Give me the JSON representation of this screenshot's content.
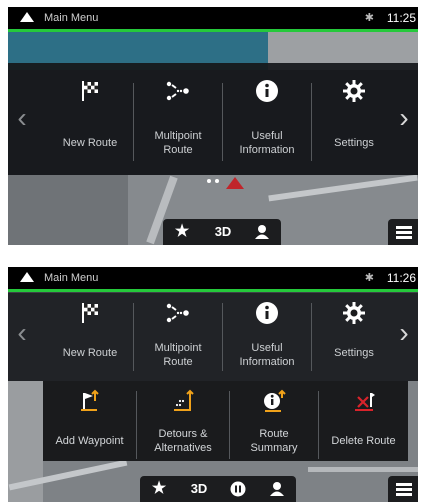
{
  "screens": [
    {
      "status": {
        "title": "Main Menu",
        "time": "11:25"
      },
      "menu_items": [
        {
          "label": "New Route",
          "icon": "checkered-flag-icon"
        },
        {
          "label": "Multipoint Route",
          "line1": "Multipoint",
          "line2": "Route",
          "icon": "multipoint-route-icon"
        },
        {
          "label": "Useful Information",
          "line1": "Useful",
          "line2": "Information",
          "icon": "info-icon"
        },
        {
          "label": "Settings",
          "icon": "gear-icon"
        }
      ],
      "bottombar": {
        "view_mode": "3D"
      }
    },
    {
      "status": {
        "title": "Main Menu",
        "time": "11:26"
      },
      "menu_items": [
        {
          "label": "New Route",
          "icon": "checkered-flag-icon"
        },
        {
          "label": "Multipoint Route",
          "line1": "Multipoint",
          "line2": "Route",
          "icon": "multipoint-route-icon"
        },
        {
          "label": "Useful Information",
          "line1": "Useful",
          "line2": "Information",
          "icon": "info-icon"
        },
        {
          "label": "Settings",
          "icon": "gear-icon"
        }
      ],
      "submenu_items": [
        {
          "label": "Add Waypoint",
          "icon": "add-waypoint-icon"
        },
        {
          "label": "Detours & Alternatives",
          "line1": "Detours &",
          "line2": "Alternatives",
          "icon": "detours-icon"
        },
        {
          "label": "Route Summary",
          "line1": "Route",
          "line2": "Summary",
          "icon": "route-summary-icon"
        },
        {
          "label": "Delete Route",
          "icon": "delete-route-icon"
        }
      ],
      "bottombar": {
        "view_mode": "3D"
      }
    }
  ],
  "colors": {
    "accent_green": "#25c93b",
    "accent_orange": "#f0a21a",
    "delete_red": "#d9232b",
    "status_bar": "#000000"
  }
}
